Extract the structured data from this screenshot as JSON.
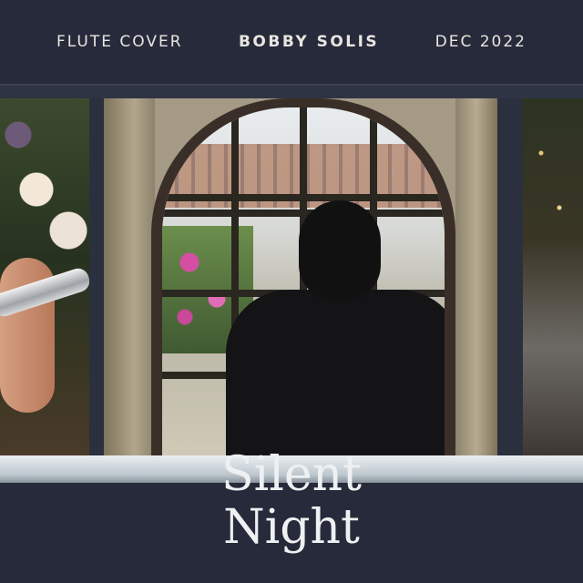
{
  "header": {
    "left": "FLUTE COVER",
    "center": "BOBBY SOLIS",
    "right": "DEC 2022"
  },
  "title": {
    "line1": "Silent",
    "line2": "Night"
  },
  "colors": {
    "background": "#262a3a",
    "text": "#e9e6e1"
  }
}
